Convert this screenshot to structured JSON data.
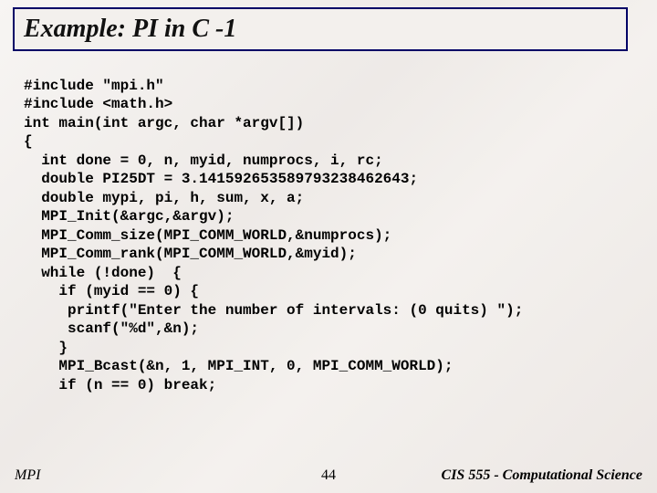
{
  "title": "Example:  PI in C -1",
  "code_lines": [
    "#include \"mpi.h\"",
    "#include <math.h>",
    "int main(int argc, char *argv[])",
    "{",
    "  int done = 0, n, myid, numprocs, i, rc;",
    "  double PI25DT = 3.141592653589793238462643;",
    "  double mypi, pi, h, sum, x, a;",
    "  MPI_Init(&argc,&argv);",
    "  MPI_Comm_size(MPI_COMM_WORLD,&numprocs);",
    "  MPI_Comm_rank(MPI_COMM_WORLD,&myid);",
    "  while (!done)  {",
    "    if (myid == 0) {",
    "     printf(\"Enter the number of intervals: (0 quits) \");",
    "     scanf(\"%d\",&n);",
    "    }",
    "    MPI_Bcast(&n, 1, MPI_INT, 0, MPI_COMM_WORLD);",
    "    if (n == 0) break;"
  ],
  "footer": {
    "left": "MPI",
    "center": "44",
    "right": "CIS 555 - Computational Science"
  }
}
